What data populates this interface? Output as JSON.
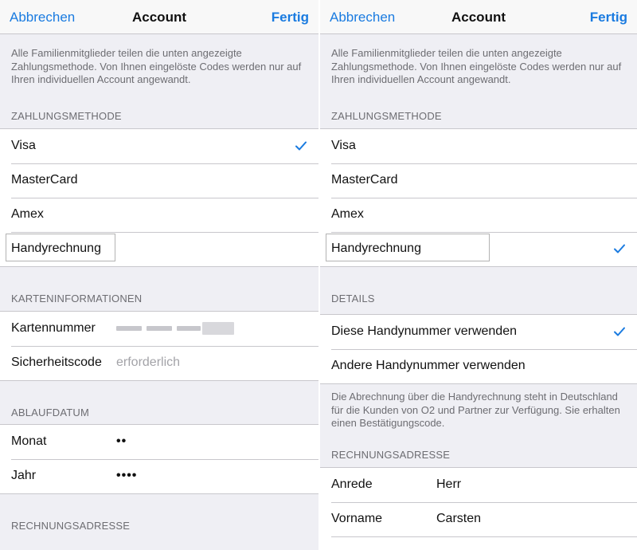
{
  "colors": {
    "accent": "#1a7be0",
    "background": "#efeff4",
    "cell": "#ffffff",
    "secondary_text": "#6d6d72"
  },
  "left": {
    "nav": {
      "cancel": "Abbrechen",
      "title": "Account",
      "done": "Fertig"
    },
    "intro": "Alle Familienmitglieder teilen die unten angezeigte Zahlungsmethode. Von Ihnen eingelöste Codes werden nur auf Ihren individuellen Account angewandt.",
    "payment_header": "ZAHLUNGSMETHODE",
    "payment_options": [
      {
        "label": "Visa",
        "selected": true
      },
      {
        "label": "MasterCard",
        "selected": false
      },
      {
        "label": "Amex",
        "selected": false
      },
      {
        "label": "Handyrechnung",
        "selected": false
      }
    ],
    "card_header": "KARTENINFORMATIONEN",
    "card_number_label": "Kartennummer",
    "security_code_label": "Sicherheitscode",
    "security_code_placeholder": "erforderlich",
    "expiry_header": "ABLAUFDATUM",
    "month_label": "Monat",
    "month_value": "••",
    "year_label": "Jahr",
    "year_value": "••••",
    "billing_header": "RECHNUNGSADRESSE"
  },
  "right": {
    "nav": {
      "cancel": "Abbrechen",
      "title": "Account",
      "done": "Fertig"
    },
    "intro": "Alle Familienmitglieder teilen die unten angezeigte Zahlungsmethode. Von Ihnen eingelöste Codes werden nur auf Ihren individuellen Account angewandt.",
    "payment_header": "ZAHLUNGSMETHODE",
    "payment_options": [
      {
        "label": "Visa",
        "selected": false
      },
      {
        "label": "MasterCard",
        "selected": false
      },
      {
        "label": "Amex",
        "selected": false
      },
      {
        "label": "Handyrechnung",
        "selected": true
      }
    ],
    "details_header": "DETAILS",
    "details_options": [
      {
        "label": "Diese Handynummer verwenden",
        "selected": true
      },
      {
        "label": "Andere Handynummer verwenden",
        "selected": false
      }
    ],
    "details_note": "Die Abrechnung über die Handyrechnung steht in Deutschland für die Kunden von O2 und Partner zur Verfügung. Sie erhalten einen Bestätigungscode.",
    "billing_header": "RECHNUNGSADRESSE",
    "salutation_label": "Anrede",
    "salutation_value": "Herr",
    "first_name_label": "Vorname",
    "first_name_value": "Carsten"
  }
}
